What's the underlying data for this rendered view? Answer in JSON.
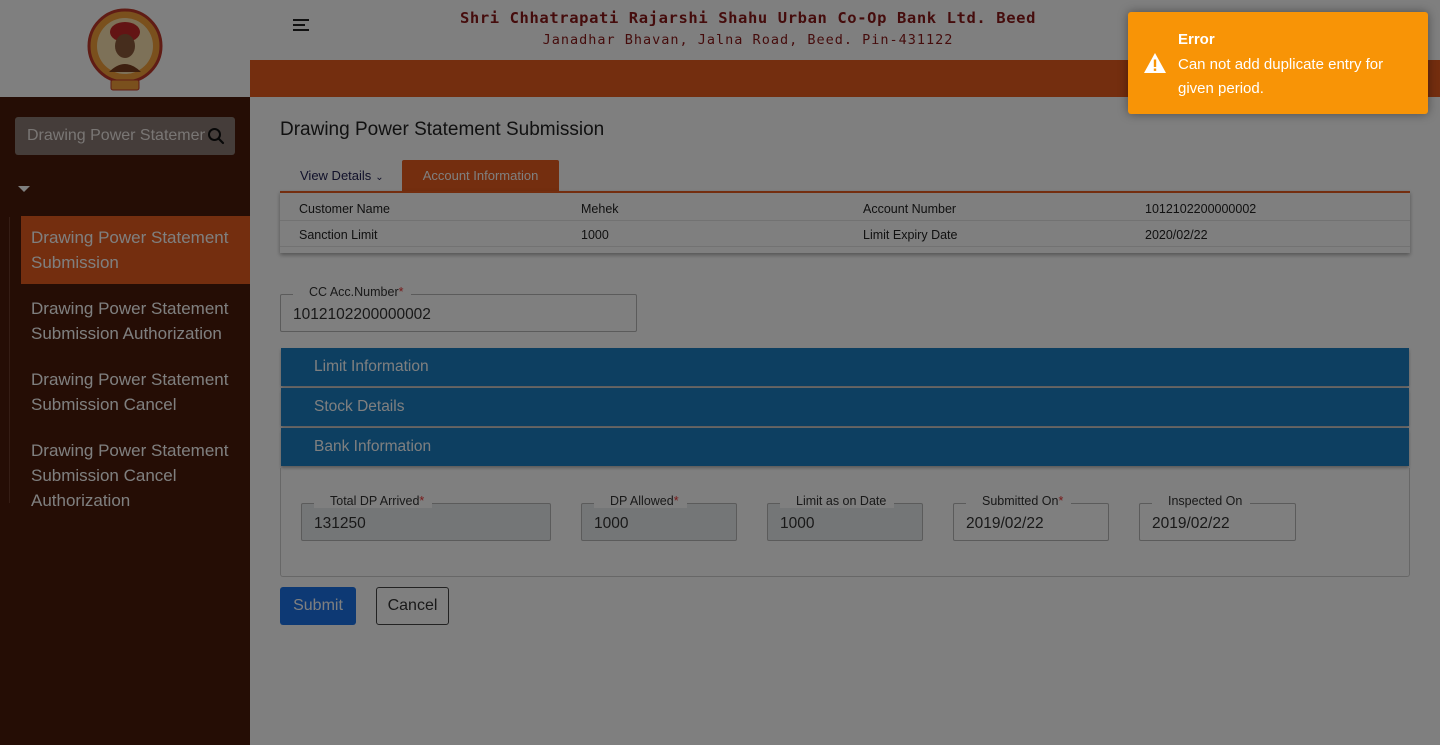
{
  "header": {
    "bank_name": "Shri Chhatrapati Rajarshi Shahu Urban Co-Op Bank Ltd. Beed",
    "bank_address": "Janadhar Bhavan, Jalna Road, Beed. Pin-431122",
    "menu_icon": "hamburger-icon",
    "logo": "bank-logo"
  },
  "sidebar": {
    "search_value": "Drawing Power Statement S",
    "search_icon": "search-icon",
    "items": [
      {
        "label": "Drawing Power Statement Submission",
        "active": true
      },
      {
        "label": "Drawing Power Statement Submission Authorization",
        "active": false
      },
      {
        "label": "Drawing Power Statement Submission Cancel",
        "active": false
      },
      {
        "label": "Drawing Power Statement Submission Cancel Authorization",
        "active": false
      }
    ]
  },
  "page": {
    "title": "Drawing Power Statement Submission",
    "tabs": {
      "view_details": "View Details",
      "account_information": "Account Information"
    }
  },
  "account_info": {
    "customer_name_label": "Customer Name",
    "customer_name": "Mehek",
    "account_number_label": "Account Number",
    "account_number": "1012102200000002",
    "sanction_limit_label": "Sanction Limit",
    "sanction_limit": "1000",
    "limit_expiry_label": "Limit Expiry Date",
    "limit_expiry": "2020/02/22"
  },
  "cc_acc": {
    "label": "CC Acc.Number",
    "required": "*",
    "value": "1012102200000002"
  },
  "sections": [
    "Limit Information",
    "Stock Details",
    "Bank Information"
  ],
  "bank_info": {
    "total_dp_arrived": {
      "label": "Total DP Arrived",
      "required": "*",
      "value": "131250"
    },
    "dp_allowed": {
      "label": "DP Allowed",
      "required": "*",
      "value": "1000"
    },
    "limit_as_on_date": {
      "label": "Limit as on Date",
      "value": "1000"
    },
    "submitted_on": {
      "label": "Submitted On",
      "required": "*",
      "value": "2019/02/22"
    },
    "inspected_on": {
      "label": "Inspected On",
      "value": "2019/02/22"
    }
  },
  "buttons": {
    "submit": "Submit",
    "cancel": "Cancel"
  },
  "toast": {
    "title": "Error",
    "message": "Can not add duplicate entry for given period.",
    "icon": "warning-icon",
    "color": "#f89406"
  },
  "colors": {
    "accent": "#e85c1e",
    "section_header": "#1a7fc2",
    "sidebar": "#4a1a0a",
    "primary_button": "#1a73e8"
  }
}
